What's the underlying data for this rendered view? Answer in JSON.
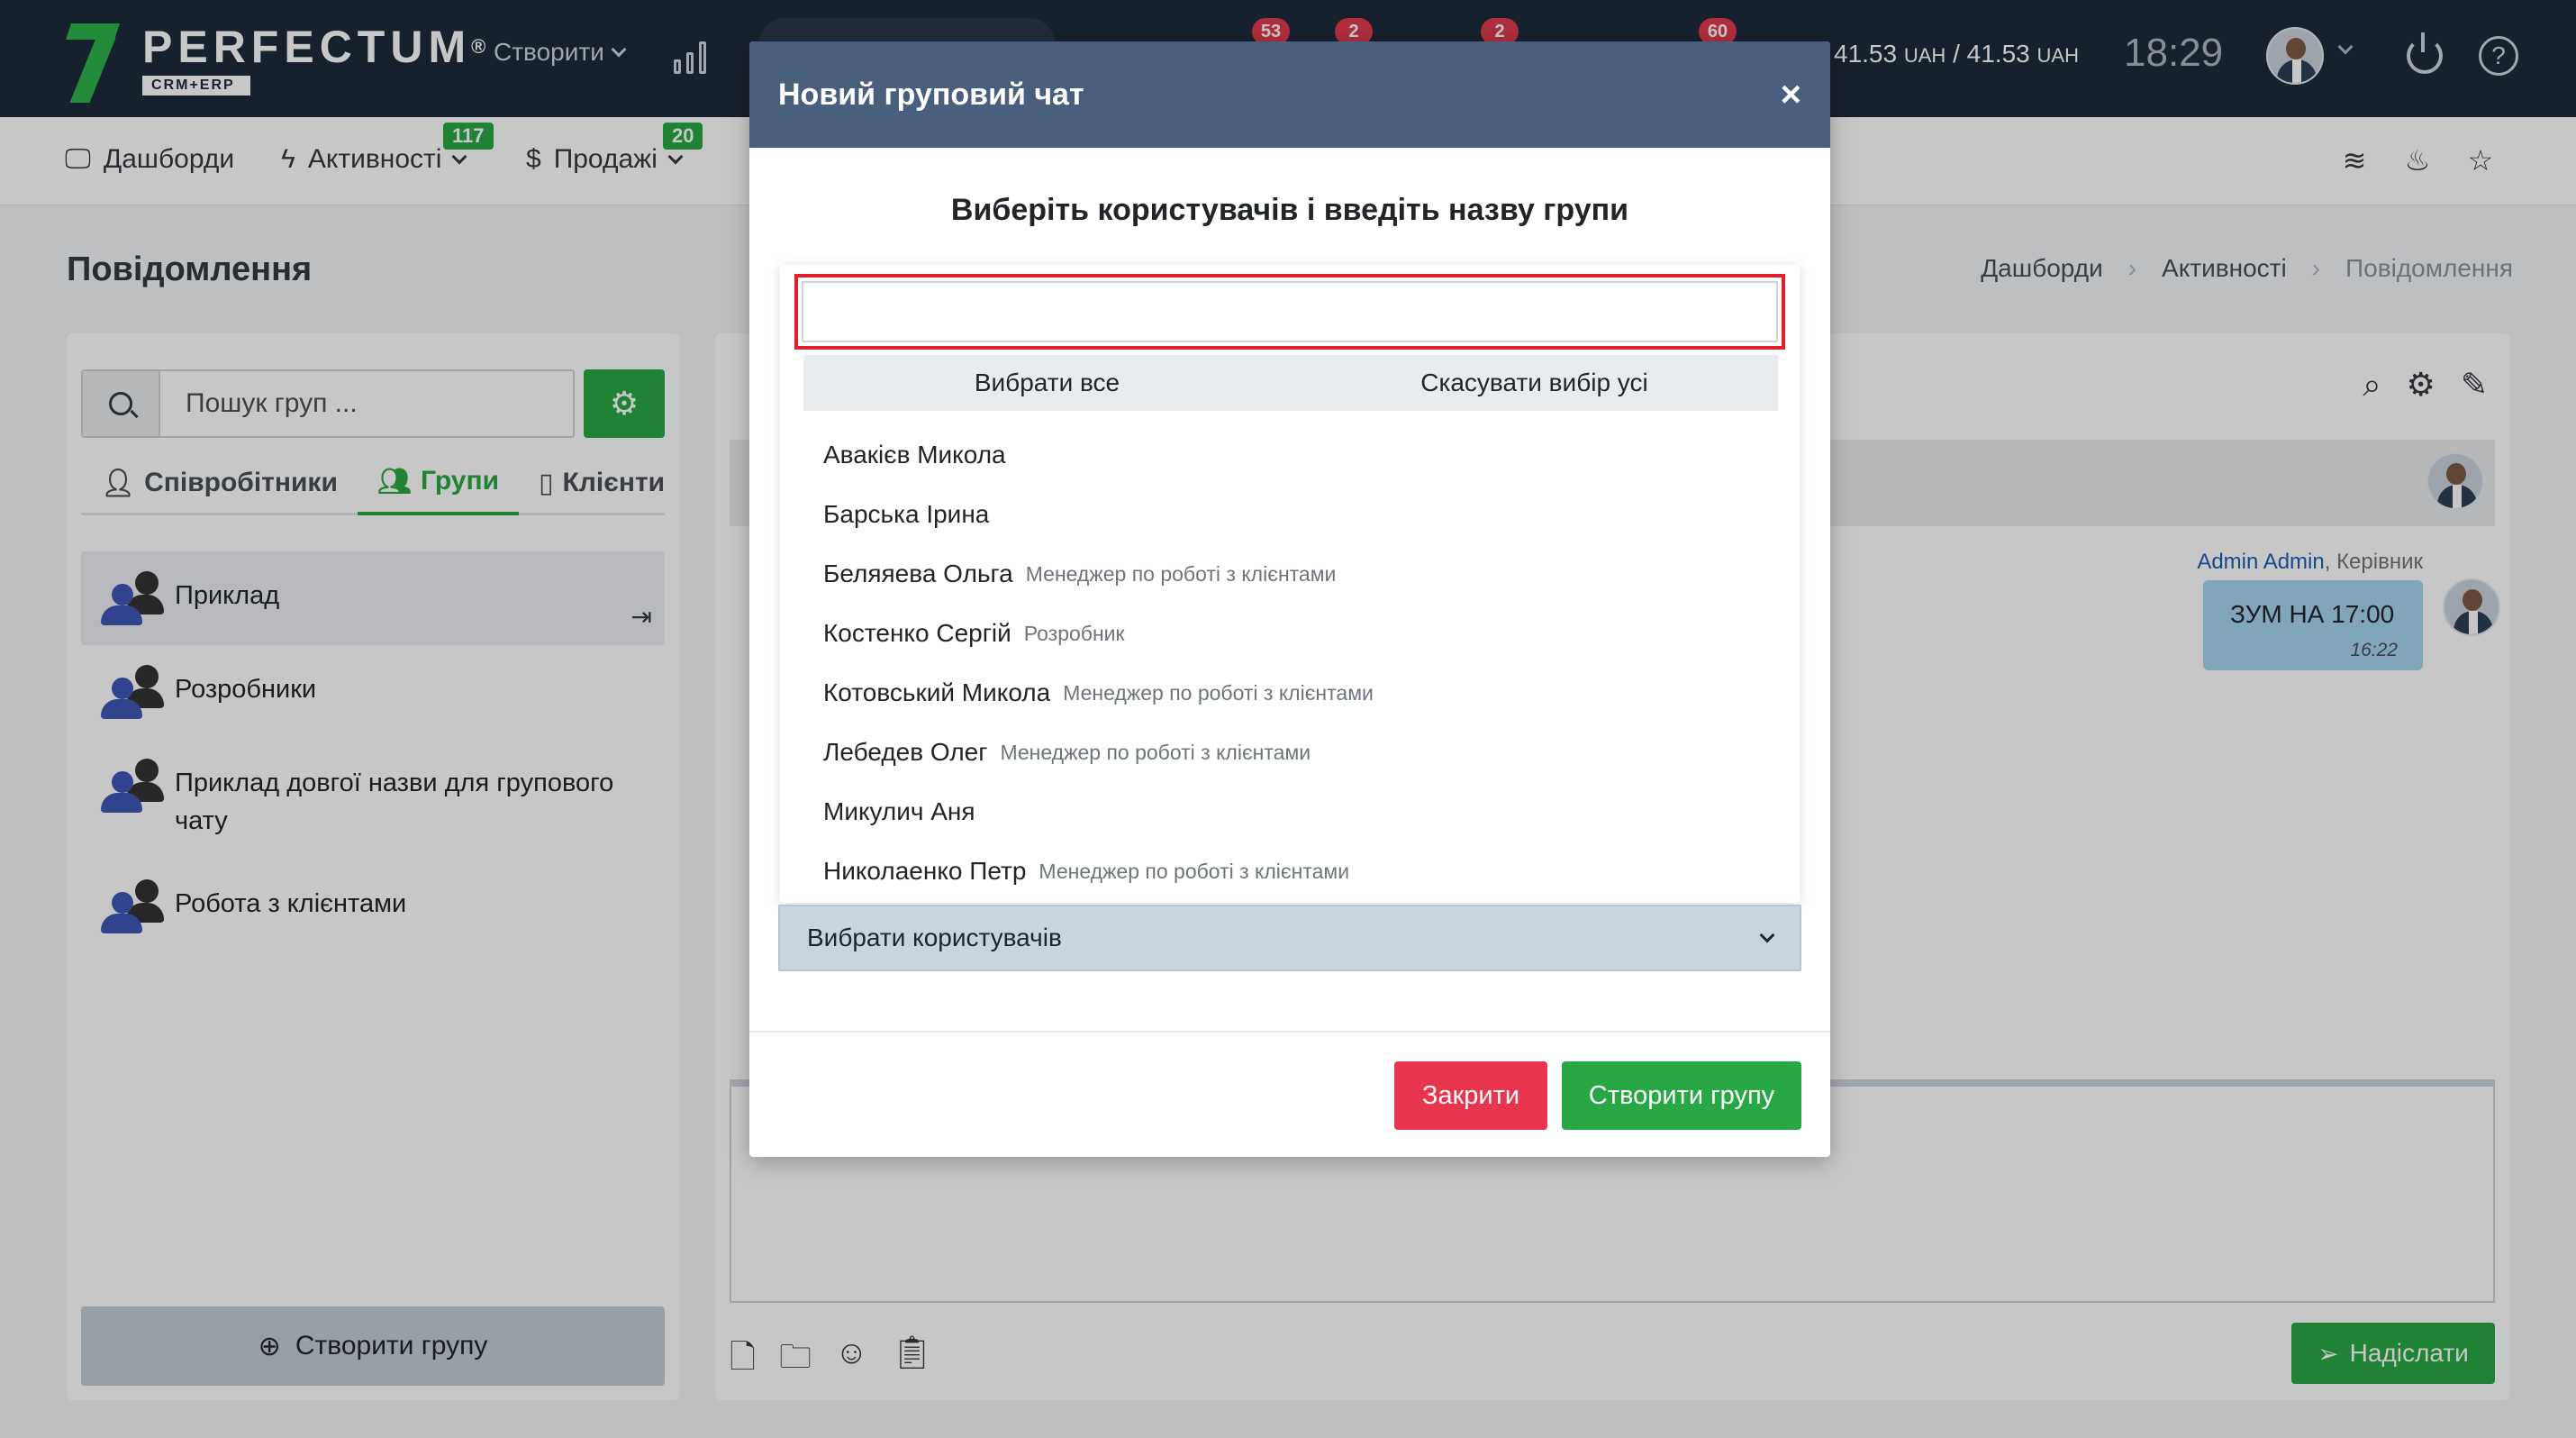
{
  "header": {
    "logo_text": "PERFECTUM",
    "logo_reg": "®",
    "logo_sub": "CRM+ERP",
    "create_label": "Створити",
    "badges": [
      "53",
      "2",
      "2",
      "60"
    ],
    "currency_value1": "41.53",
    "currency_unit1": "UAH",
    "currency_sep": "/",
    "currency_value2": "41.53",
    "currency_unit2": "UAH",
    "clock": "18:29"
  },
  "nav": {
    "items": [
      {
        "label": "Дашборди"
      },
      {
        "label": "Активності",
        "badge": "117"
      },
      {
        "label": "Продажі",
        "badge": "20"
      }
    ]
  },
  "page": {
    "title": "Повідомлення",
    "breadcrumb": [
      "Дашборди",
      "Активності",
      "Повідомлення"
    ]
  },
  "left_panel": {
    "search_placeholder": "Пошук груп ...",
    "tabs": [
      "Співробітники",
      "Групи",
      "Клієнти"
    ],
    "groups": [
      "Приклад",
      "Розробники",
      "Приклад довгої назви для групового чату",
      "Робота з клієнтами"
    ],
    "create_group_label": "Створити групу"
  },
  "chat": {
    "author": "Admin Admin",
    "role": "Керівник",
    "message": "ЗУМ НА 17:00",
    "time": "16:22",
    "send_label": "Надіслати"
  },
  "modal": {
    "title": "Новий груповий чат",
    "close_symbol": "×",
    "subtitle": "Виберіть користувачів і введіть назву групи",
    "search_value": "",
    "select_all": "Вибрати все",
    "deselect_all": "Скасувати вибір усі",
    "users": [
      {
        "name": "Авакієв Микола",
        "role": ""
      },
      {
        "name": "Барська Ірина",
        "role": ""
      },
      {
        "name": "Беляяева Ольга",
        "role": "Менеджер по роботі з клієнтами"
      },
      {
        "name": "Костенко Сергій",
        "role": "Розробник"
      },
      {
        "name": "Котовський Микола",
        "role": "Менеджер по роботі з клієнтами"
      },
      {
        "name": "Лебедев Олег",
        "role": "Менеджер по роботі з клієнтами"
      },
      {
        "name": "Микулич Аня",
        "role": ""
      },
      {
        "name": "Николаенко Петр",
        "role": "Менеджер по роботі з клієнтами"
      }
    ],
    "select_placeholder": "Вибрати користувачів",
    "btn_close": "Закрити",
    "btn_create": "Створити групу"
  },
  "colors": {
    "header_bg": "#1e2a3a",
    "accent_green": "#28a745",
    "modal_header": "#4a5e7e",
    "danger": "#e8344c"
  }
}
